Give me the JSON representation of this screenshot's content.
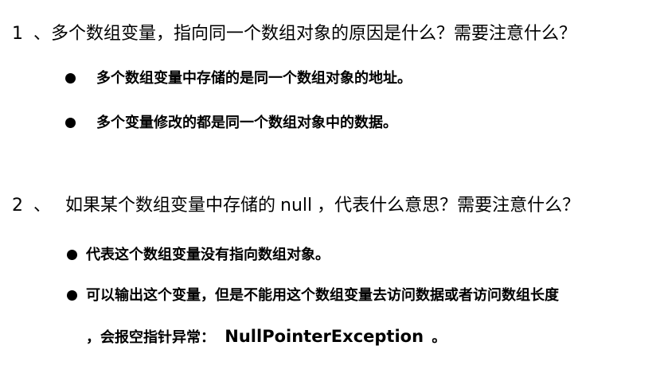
{
  "q1": {
    "number": "1",
    "sep": "、",
    "text": "多个数组变量，指向同一个数组对象的原因是什么？需要注意什么？",
    "bullets": [
      "多个数组变量中存储的是同一个数组对象的地址。",
      "多个变量修改的都是同一个数组对象中的数据。"
    ]
  },
  "q2": {
    "number": "2",
    "sep": "、",
    "text_before": "如果某个数组变量中存储的",
    "null_word": "null",
    "text_after": "，代表什么意思？需要注意什么？",
    "bullets": [
      "代表这个数组变量没有指向数组对象。",
      "可以输出这个变量，但是不能用这个数组变量去访问数据或者访问数组长度"
    ],
    "continuation_prefix": "，会报空指针异常：",
    "exception_name": "NullPointerException",
    "continuation_suffix": "。"
  }
}
